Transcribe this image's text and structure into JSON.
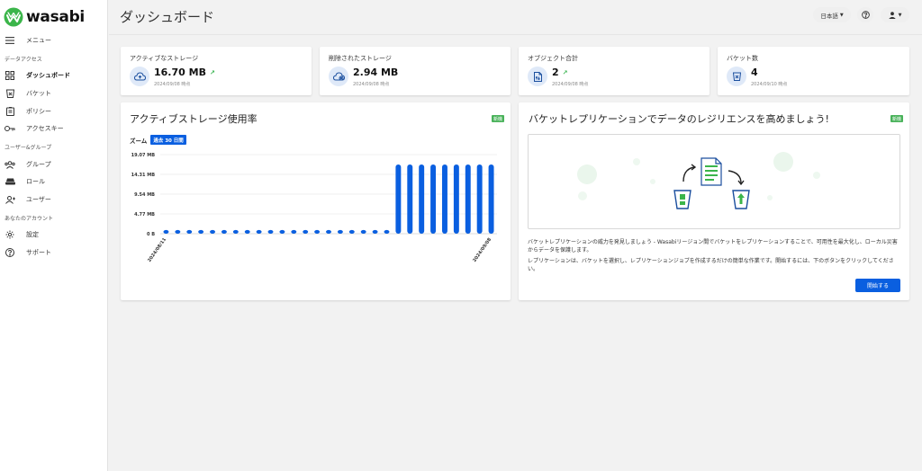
{
  "app": {
    "logo_text": "wasabi"
  },
  "sidebar": {
    "menu_label": "メニュー",
    "sections": {
      "data_access": "データアクセス",
      "users_groups": "ユーザー&グループ",
      "your_account": "あなたのアカウント"
    },
    "items": [
      {
        "label": "ダッシュボード",
        "icon": "dashboard-icon",
        "active": true
      },
      {
        "label": "バケット",
        "icon": "bucket-icon"
      },
      {
        "label": "ポリシー",
        "icon": "policy-icon"
      },
      {
        "label": "アクセスキー",
        "icon": "key-icon"
      },
      {
        "label": "グループ",
        "icon": "group-icon"
      },
      {
        "label": "ロール",
        "icon": "role-icon"
      },
      {
        "label": "ユーザー",
        "icon": "user-icon"
      },
      {
        "label": "設定",
        "icon": "gear-icon"
      },
      {
        "label": "サポート",
        "icon": "help-icon"
      }
    ]
  },
  "header": {
    "title": "ダッシュボード",
    "language": "日本語",
    "help_icon": "help-circle-icon",
    "account_icon": "account-icon"
  },
  "stats": [
    {
      "title": "アクティブなストレージ",
      "value": "16.70 MB",
      "trend": "↗",
      "date": "2024/09/08 時点",
      "icon": "cloud-upload-icon"
    },
    {
      "title": "削除されたストレージ",
      "value": "2.94 MB",
      "trend": "",
      "date": "2024/09/08 時点",
      "icon": "cloud-delete-icon"
    },
    {
      "title": "オブジェクト合計",
      "value": "2",
      "trend": "↗",
      "date": "2024/09/08 時点",
      "icon": "file-icon"
    },
    {
      "title": "バケット数",
      "value": "4",
      "trend": "",
      "date": "2024/09/10 時点",
      "icon": "bucket-icon"
    }
  ],
  "storage_chart": {
    "title": "アクティブストレージ使用率",
    "badge": "新機",
    "zoom_label": "ズーム",
    "zoom_value": "過去 30 日間"
  },
  "chart_data": {
    "type": "bar",
    "title": "アクティブストレージ使用率",
    "y_ticks": [
      "19.07 MB",
      "14.31 MB",
      "9.54 MB",
      "4.77 MB",
      "0 B"
    ],
    "y_tick_values": [
      19.07,
      14.31,
      9.54,
      4.77,
      0
    ],
    "ylim": [
      0,
      19.07
    ],
    "x_tick_labels": [
      "2024/08/11",
      "2024/09/08"
    ],
    "values": [
      0.9,
      0.9,
      0.9,
      0.9,
      0.9,
      0.9,
      0.9,
      0.9,
      0.9,
      0.9,
      0.9,
      0.9,
      0.9,
      0.9,
      0.9,
      0.9,
      0.9,
      0.9,
      0.9,
      0.9,
      16.7,
      16.7,
      16.7,
      16.7,
      16.7,
      16.7,
      16.7,
      16.7,
      16.7
    ],
    "color": "#0a5fe0",
    "grid": true
  },
  "replication": {
    "title": "バケットレプリケーションでデータのレジリエンスを高めましょう!",
    "badge": "新機",
    "text1": "バケットレプリケーションの威力を発見しましょう - Wasabiリージョン間でバケットをレプリケーションすることで、可用性を最大化し、ローカル災害からデータを保護します。",
    "text2": "レプリケーションは、バケットを選択し、レプリケーションジョブを作成するだけの簡単な作業です。開始するには、下のボタンをクリックしてください。",
    "button": "開始する"
  },
  "colors": {
    "accent": "#0a5fe0",
    "brand_green": "#3bb54a",
    "new_badge": "#49b25a"
  }
}
